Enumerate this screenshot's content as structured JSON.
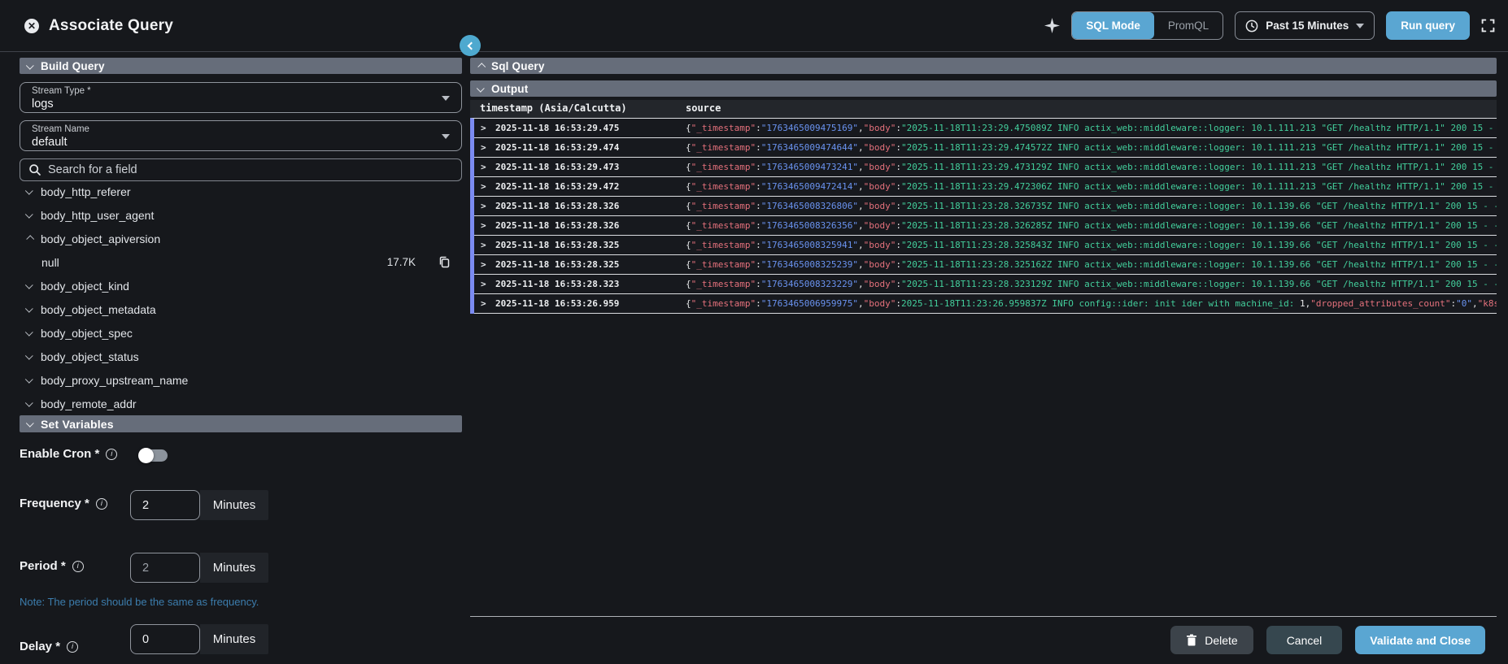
{
  "header": {
    "title": "Associate Query",
    "mode_sql": "SQL Mode",
    "mode_promql": "PromQL",
    "time_range": "Past 15 Minutes",
    "run_button": "Run query"
  },
  "left": {
    "build_query_header": "Build Query",
    "stream_type_label": "Stream Type *",
    "stream_type_value": "logs",
    "stream_name_label": "Stream Name",
    "stream_name_value": "default",
    "search_placeholder": "Search for a field",
    "fields": [
      {
        "name": "body_http_referer"
      },
      {
        "name": "body_http_user_agent"
      },
      {
        "name": "body_object_apiversion",
        "expanded": true
      },
      {
        "name": "null",
        "child": true,
        "count": "17.7K"
      },
      {
        "name": "body_object_kind"
      },
      {
        "name": "body_object_metadata"
      },
      {
        "name": "body_object_spec"
      },
      {
        "name": "body_object_status"
      },
      {
        "name": "body_proxy_upstream_name"
      },
      {
        "name": "body_remote_addr"
      }
    ],
    "set_variables_header": "Set Variables",
    "enable_cron_label": "Enable Cron *",
    "enable_cron_on": false,
    "frequency_label": "Frequency *",
    "frequency_value": "2",
    "frequency_unit": "Minutes",
    "period_label": "Period *",
    "period_value": "2",
    "period_unit": "Minutes",
    "note": "Note: The period should be the same as frequency.",
    "delay_label": "Delay *",
    "delay_value": "0",
    "delay_unit": "Minutes"
  },
  "right": {
    "sql_query_header": "Sql Query",
    "output_header": "Output",
    "columns": {
      "timestamp": "timestamp (Asia/Calcutta)",
      "source": "source"
    },
    "rows": [
      {
        "time": "2025-11-18 16:53:29.475",
        "segments": [
          [
            "p",
            "{"
          ],
          [
            "k",
            "\"_timestamp\""
          ],
          [
            "p",
            ":"
          ],
          [
            "n",
            "\"1763465009475169\""
          ],
          [
            "p",
            ","
          ],
          [
            "k",
            "\"body\""
          ],
          [
            "p",
            ":"
          ],
          [
            "s",
            "\"2025-11-18T11:23:29.475089Z INFO actix_web::middleware::logger: 10.1.111.213 \"GET /healthz HTTP/1.1\" 200 15 - "
          ]
        ]
      },
      {
        "time": "2025-11-18 16:53:29.474",
        "segments": [
          [
            "p",
            "{"
          ],
          [
            "k",
            "\"_timestamp\""
          ],
          [
            "p",
            ":"
          ],
          [
            "n",
            "\"1763465009474644\""
          ],
          [
            "p",
            ","
          ],
          [
            "k",
            "\"body\""
          ],
          [
            "p",
            ":"
          ],
          [
            "s",
            "\"2025-11-18T11:23:29.474572Z INFO actix_web::middleware::logger: 10.1.111.213 \"GET /healthz HTTP/1.1\" 200 15 - "
          ]
        ]
      },
      {
        "time": "2025-11-18 16:53:29.473",
        "segments": [
          [
            "p",
            "{"
          ],
          [
            "k",
            "\"_timestamp\""
          ],
          [
            "p",
            ":"
          ],
          [
            "n",
            "\"1763465009473241\""
          ],
          [
            "p",
            ","
          ],
          [
            "k",
            "\"body\""
          ],
          [
            "p",
            ":"
          ],
          [
            "s",
            "\"2025-11-18T11:23:29.473129Z INFO actix_web::middleware::logger: 10.1.111.213 \"GET /healthz HTTP/1.1\" 200 15 - "
          ]
        ]
      },
      {
        "time": "2025-11-18 16:53:29.472",
        "segments": [
          [
            "p",
            "{"
          ],
          [
            "k",
            "\"_timestamp\""
          ],
          [
            "p",
            ":"
          ],
          [
            "n",
            "\"1763465009472414\""
          ],
          [
            "p",
            ","
          ],
          [
            "k",
            "\"body\""
          ],
          [
            "p",
            ":"
          ],
          [
            "s",
            "\"2025-11-18T11:23:29.472306Z INFO actix_web::middleware::logger: 10.1.111.213 \"GET /healthz HTTP/1.1\" 200 15 - "
          ]
        ]
      },
      {
        "time": "2025-11-18 16:53:28.326",
        "segments": [
          [
            "p",
            "{"
          ],
          [
            "k",
            "\"_timestamp\""
          ],
          [
            "p",
            ":"
          ],
          [
            "n",
            "\"1763465008326806\""
          ],
          [
            "p",
            ","
          ],
          [
            "k",
            "\"body\""
          ],
          [
            "p",
            ":"
          ],
          [
            "s",
            "\"2025-11-18T11:23:28.326735Z INFO actix_web::middleware::logger: 10.1.139.66 \"GET /healthz HTTP/1.1\" 200 15 - -"
          ]
        ]
      },
      {
        "time": "2025-11-18 16:53:28.326",
        "segments": [
          [
            "p",
            "{"
          ],
          [
            "k",
            "\"_timestamp\""
          ],
          [
            "p",
            ":"
          ],
          [
            "n",
            "\"1763465008326356\""
          ],
          [
            "p",
            ","
          ],
          [
            "k",
            "\"body\""
          ],
          [
            "p",
            ":"
          ],
          [
            "s",
            "\"2025-11-18T11:23:28.326285Z INFO actix_web::middleware::logger: 10.1.139.66 \"GET /healthz HTTP/1.1\" 200 15 - -"
          ]
        ]
      },
      {
        "time": "2025-11-18 16:53:28.325",
        "segments": [
          [
            "p",
            "{"
          ],
          [
            "k",
            "\"_timestamp\""
          ],
          [
            "p",
            ":"
          ],
          [
            "n",
            "\"1763465008325941\""
          ],
          [
            "p",
            ","
          ],
          [
            "k",
            "\"body\""
          ],
          [
            "p",
            ":"
          ],
          [
            "s",
            "\"2025-11-18T11:23:28.325843Z INFO actix_web::middleware::logger: 10.1.139.66 \"GET /healthz HTTP/1.1\" 200 15 - -"
          ]
        ]
      },
      {
        "time": "2025-11-18 16:53:28.325",
        "segments": [
          [
            "p",
            "{"
          ],
          [
            "k",
            "\"_timestamp\""
          ],
          [
            "p",
            ":"
          ],
          [
            "n",
            "\"1763465008325239\""
          ],
          [
            "p",
            ","
          ],
          [
            "k",
            "\"body\""
          ],
          [
            "p",
            ":"
          ],
          [
            "s",
            "\"2025-11-18T11:23:28.325162Z INFO actix_web::middleware::logger: 10.1.139.66 \"GET /healthz HTTP/1.1\" 200 15 - -"
          ]
        ]
      },
      {
        "time": "2025-11-18 16:53:28.323",
        "segments": [
          [
            "p",
            "{"
          ],
          [
            "k",
            "\"_timestamp\""
          ],
          [
            "p",
            ":"
          ],
          [
            "n",
            "\"1763465008323229\""
          ],
          [
            "p",
            ","
          ],
          [
            "k",
            "\"body\""
          ],
          [
            "p",
            ":"
          ],
          [
            "s",
            "\"2025-11-18T11:23:28.323129Z INFO actix_web::middleware::logger: 10.1.139.66 \"GET /healthz HTTP/1.1\" 200 15 - -"
          ]
        ]
      },
      {
        "time": "2025-11-18 16:53:26.959",
        "segments": [
          [
            "p",
            "{"
          ],
          [
            "k",
            "\"_timestamp\""
          ],
          [
            "p",
            ":"
          ],
          [
            "n",
            "\"1763465006959975\""
          ],
          [
            "p",
            ","
          ],
          [
            "k",
            "\"body\""
          ],
          [
            "p",
            ":"
          ],
          [
            "s",
            "2025-11-18T11:23:26.959837Z INFO config::ider: init ider with machine_id:"
          ],
          [
            "p",
            " 1,"
          ],
          [
            "k",
            "\"dropped_attributes_count\""
          ],
          [
            "p",
            ":"
          ],
          [
            "n",
            "\"0\""
          ],
          [
            "p",
            ","
          ],
          [
            "k",
            "\"k8s"
          ]
        ]
      }
    ],
    "footer": {
      "delete": "Delete",
      "cancel": "Cancel",
      "validate": "Validate and Close"
    }
  },
  "colors": {
    "accent": "#5aa6d2",
    "row_marker": "#7b8bf2",
    "json_key": "#e5717c",
    "json_number": "#6a93f0",
    "json_string": "#43cf9c",
    "note": "#3c7dad",
    "section_bar": "#666d7a"
  }
}
